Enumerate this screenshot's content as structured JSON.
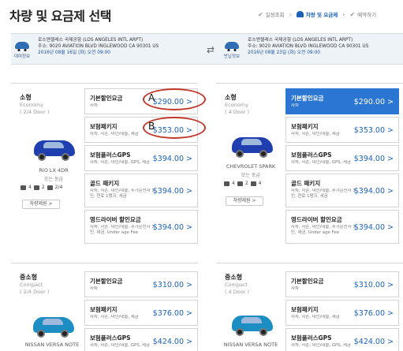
{
  "header": {
    "title": "차량 및 요금제 선택",
    "steps": [
      "일정조회",
      "차량 및 요금제",
      "예약하기"
    ]
  },
  "trip": {
    "pickup": {
      "label": "대여정보",
      "location": "로스앤젤레스 국제공항 (LOS ANGELES INTL ARPT)",
      "address": "주소: 9020 AVIATION BLVD INGLEWOOD CA 90301 US",
      "datetime": "2016년 08월 16일 (화) 오전 09:00"
    },
    "dropoff": {
      "label": "반납정보",
      "location": "로스앤젤레스 국제공항 (LOS ANGELES INTL ARPT)",
      "address": "주소: 9020 AVIATION BLVD INGLEWOOD CA 90301 US",
      "datetime": "2016년 08월 23일 (화) 오전 09:00"
    }
  },
  "annotations": [
    "A",
    "B"
  ],
  "cars": [
    {
      "class": "소형",
      "class_en": "Economy",
      "doors": "( 2/4 Door )",
      "model": "RIO LX 4DR",
      "model_sub": "또는 동급",
      "specs": [
        "4",
        "2",
        "2/4"
      ],
      "detail_label": "차량제원 >",
      "options": [
        {
          "name": "기본할인요금",
          "desc": "자차",
          "price": "$290.00 >"
        },
        {
          "name": "보험패키지",
          "desc": "자차, 자손, 대인/대물, 세금",
          "price": "$353.00 >"
        },
        {
          "name": "보험플러스GPS",
          "desc": "자차, 자손, 대인/대물, GPS, 세금",
          "price": "$394.00 >"
        },
        {
          "name": "골드 패키지",
          "desc": "자차, 자손, 대인/대물, 추가운전자 1인, 연료 1탱크, 세금",
          "price": "$394.00 >"
        },
        {
          "name": "영드라이버 할인요금",
          "desc": "자차, 자손, 대인/대물, 추가운전자 1인, 세금, Under age Fee",
          "price": "$394.00 >"
        }
      ]
    },
    {
      "class": "소형",
      "class_en": "Economy",
      "doors": "( 4 Door )",
      "model": "CHEVROLET SPARK",
      "model_sub": "또는 동급",
      "specs": [
        "4",
        "2",
        "4"
      ],
      "detail_label": "차량제원 >",
      "options": [
        {
          "name": "기본할인요금",
          "desc": "자차",
          "price": "$290.00 >"
        },
        {
          "name": "보험패키지",
          "desc": "자차, 자손, 대인/대물, 세금",
          "price": "$353.00 >"
        },
        {
          "name": "보험플러스GPS",
          "desc": "자차, 자손, 대인/대물, GPS, 세금",
          "price": "$394.00 >"
        },
        {
          "name": "골드 패키지",
          "desc": "자차, 자손, 대인/대물, 추가운전자 1인, 연료 1탱크, 세금",
          "price": "$394.00 >"
        },
        {
          "name": "영드라이버 할인요금",
          "desc": "자차, 자손, 대인/대물, 추가운전자 1인, 세금, Under age Fee",
          "price": "$394.00 >"
        }
      ]
    },
    {
      "class": "중소형",
      "class_en": "Compact",
      "doors": "( 2/4 Door )",
      "model": "NISSAN VERSA NOTE",
      "options": [
        {
          "name": "기본할인요금",
          "desc": "자차",
          "price": "$310.00 >"
        },
        {
          "name": "보험패키지",
          "desc": "자차, 자손, 대인/대물, 세금",
          "price": "$376.00 >"
        },
        {
          "name": "보험플러스GPS",
          "desc": "자차, 자손, 대인/대물, GPS, 세금",
          "price": "$424.00 >"
        }
      ]
    },
    {
      "class": "중소형",
      "class_en": "Compact",
      "doors": "( 4 Door )",
      "model": "NISSAN VERSA NOTE",
      "options": [
        {
          "name": "기본할인요금",
          "desc": "자차",
          "price": "$310.00 >"
        },
        {
          "name": "보험패키지",
          "desc": "자차, 자손, 대인/대물, 세금",
          "price": "$376.00 >"
        },
        {
          "name": "보험플러스GPS",
          "desc": "자차, 자손, 대인/대물, GPS, 세금",
          "price": "$424.00 >"
        }
      ]
    }
  ],
  "colors": {
    "accent": "#2b76d2",
    "annotation": "#c0392b"
  }
}
